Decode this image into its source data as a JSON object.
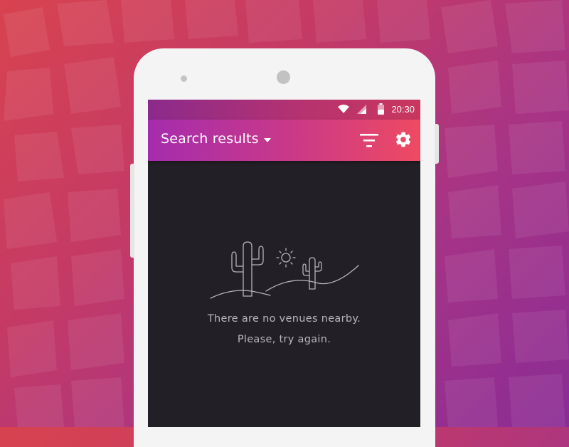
{
  "status_bar": {
    "time": "20:30",
    "icons": [
      "wifi-icon",
      "cell-signal-icon",
      "battery-icon"
    ]
  },
  "app_bar": {
    "title": "Search results",
    "dropdown_icon": "caret-down-icon",
    "actions": [
      "filter-icon",
      "gear-icon"
    ]
  },
  "empty_state": {
    "illustration": "desert-cactus-icon",
    "line1": "There are no venues nearby.",
    "line2": "Please, try again."
  },
  "colors": {
    "background_start": "#d8434f",
    "background_end": "#8a2c95",
    "app_bar_start": "#a52cae",
    "app_bar_end": "#ef4a62",
    "screen_bg": "#231f26",
    "phone_body": "#f4f4f4"
  }
}
